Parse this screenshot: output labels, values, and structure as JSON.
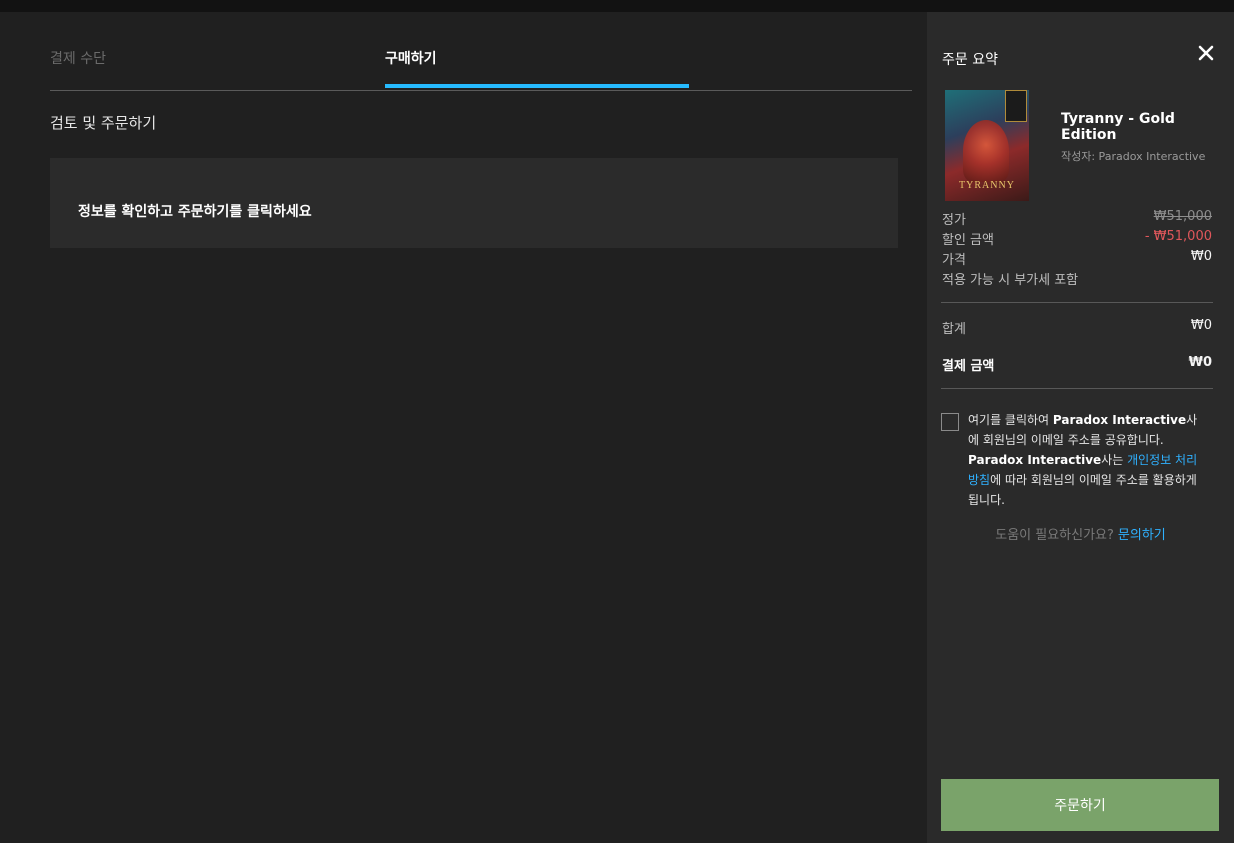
{
  "steps": {
    "payment_method": "결제 수단",
    "purchase": "구매하기"
  },
  "review": {
    "title": "검토 및 주문하기",
    "info": "정보를 확인하고 주문하기를 클릭하세요"
  },
  "summary": {
    "title": "주문 요약",
    "product": {
      "name": "Tyranny - Gold Edition",
      "publisher": "작성자: Paradox Interactive",
      "cover_text": "TYRANNY"
    },
    "price_label": "정가",
    "price_value": "₩51,000",
    "discount_label": "할인 금액",
    "discount_value": "- ₩51,000",
    "final_label": "가격",
    "final_value": "₩0",
    "vat_note": "적용 가능 시 부가세 포함",
    "subtotal_label": "합계",
    "subtotal_value": "₩0",
    "pay_label": "결제 금액",
    "pay_value": "₩0",
    "consent": {
      "part1": "여기를 클릭하여 ",
      "company": "Paradox Interactive",
      "part2": "사에 회원님의 이메일 주소를 공유합니다. ",
      "company2": "Paradox Interactive",
      "part3": "사는 ",
      "policy_link": "개인정보 처리방침",
      "part4": "에 따라 회원님의 이메일 주소를 활용하게 됩니다."
    },
    "help_text": "도움이 필요하신가요?",
    "help_link": "문의하기",
    "order_button": "주문하기"
  },
  "colors": {
    "accent": "#26bbff",
    "order_button": "#7aa36a",
    "discount": "#e0575b",
    "link": "#2fb1ff"
  }
}
